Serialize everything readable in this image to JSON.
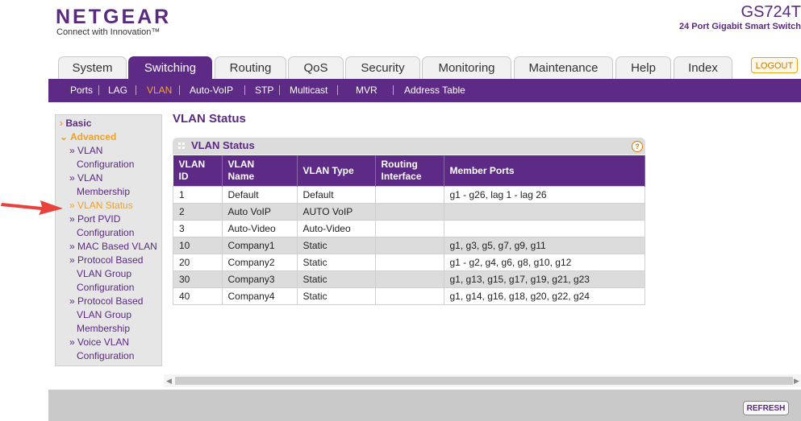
{
  "header": {
    "logo": "NETGEAR",
    "tagline": "Connect with Innovation™",
    "model": "GS724T",
    "model_sub": "24 Port Gigabit Smart Switch"
  },
  "tabs": [
    "System",
    "Switching",
    "Routing",
    "QoS",
    "Security",
    "Monitoring",
    "Maintenance",
    "Help",
    "Index"
  ],
  "logout_label": "LOGOUT",
  "subnav": [
    "Ports",
    "LAG",
    "VLAN",
    "Auto-VoIP",
    "STP",
    "Multicast",
    "MVR",
    "Address Table"
  ],
  "sidebar": {
    "basic": "Basic",
    "advanced": "Advanced",
    "items": [
      [
        "VLAN",
        "Configuration"
      ],
      [
        "VLAN",
        "Membership"
      ],
      [
        "VLAN Status"
      ],
      [
        "Port PVID",
        "Configuration"
      ],
      [
        "MAC Based VLAN"
      ],
      [
        "Protocol Based",
        "VLAN Group",
        "Configuration"
      ],
      [
        "Protocol Based",
        "VLAN Group",
        "Membership"
      ],
      [
        "Voice VLAN",
        "Configuration"
      ]
    ]
  },
  "content": {
    "page_title": "VLAN Status",
    "panel_title": "VLAN Status",
    "help_icon": "?",
    "columns": [
      [
        "VLAN",
        "ID"
      ],
      [
        "VLAN",
        "Name"
      ],
      [
        "VLAN Type"
      ],
      [
        "Routing",
        "Interface"
      ],
      [
        "Member Ports"
      ]
    ],
    "rows": [
      [
        "1",
        "Default",
        "Default",
        "",
        "g1 - g26, lag 1 - lag 26"
      ],
      [
        "2",
        "Auto VoIP",
        "AUTO VoIP",
        "",
        ""
      ],
      [
        "3",
        "Auto-Video",
        "Auto-Video",
        "",
        ""
      ],
      [
        "10",
        "Company1",
        "Static",
        "",
        "g1, g3, g5, g7, g9, g11"
      ],
      [
        "20",
        "Company2",
        "Static",
        "",
        "g1 - g2, g4, g6, g8, g10, g12"
      ],
      [
        "30",
        "Company3",
        "Static",
        "",
        "g1, g13, g15, g17, g19, g21, g23"
      ],
      [
        "40",
        "Company4",
        "Static",
        "",
        "g1, g14, g16, g18, g20, g22, g24"
      ]
    ]
  },
  "refresh_label": "REFRESH",
  "colors": {
    "brand": "#5d2a86",
    "accent": "#f0a024",
    "arrow": "#e8423a"
  }
}
